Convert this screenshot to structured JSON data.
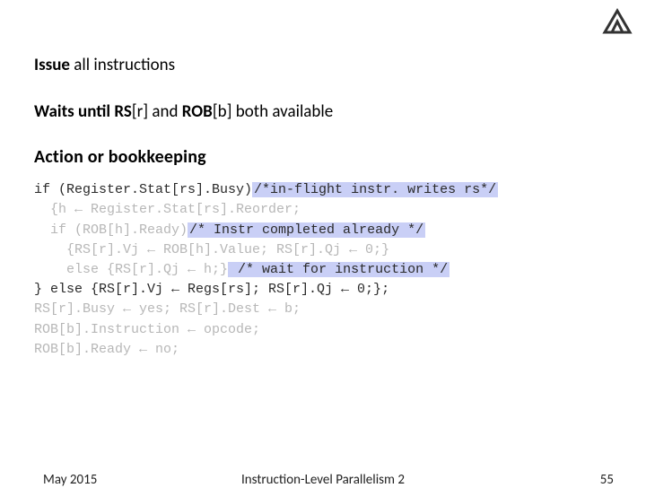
{
  "logo_name": "technion-logo",
  "heading1_bold": "Issue",
  "heading1_rest": " all instructions",
  "heading2_lead": "Waits until ",
  "heading2_rs": "RS",
  "heading2_r": "[r]",
  "heading2_mid": " and ",
  "heading2_rob": "ROB",
  "heading2_b": "[b]",
  "heading2_tail": " both available",
  "section": "Action or bookkeeping",
  "code": {
    "l1a": "if (Register.Stat[rs].Busy)",
    "l1b": "/*in-flight instr. writes rs*/",
    "l2": "  {h ← Register.Stat[rs].Reorder;",
    "l3a": "  if (ROB[h].Ready)",
    "l3b": "/* Instr completed already */",
    "l4": "    {RS[r].Vj ← ROB[h].Value; RS[r].Qj ← 0;}",
    "l5a": "    else {RS[r].Qj ← h;}",
    "l5b": " /* wait for instruction */",
    "l6": "} else {RS[r].Vj ← Regs[rs]; RS[r].Qj ← 0;};",
    "l7": "RS[r].Busy ← yes; RS[r].Dest ← b;",
    "l8": "ROB[b].Instruction ← opcode;",
    "l9": "ROB[b].Ready ← no;"
  },
  "footer": {
    "date": "May 2015",
    "title": "Instruction-Level Parallelism 2",
    "page": "55"
  }
}
